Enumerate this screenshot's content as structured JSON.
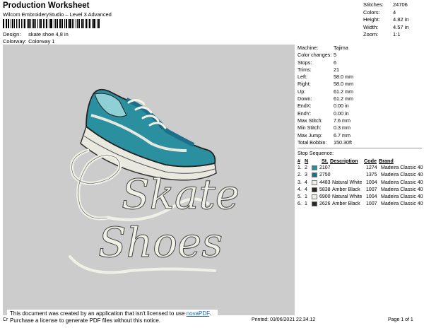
{
  "header": {
    "title": "Production Worksheet",
    "subtitle": "Wilcom EmbroideryStudio – Level 3 Advanced",
    "design_label": "Design:",
    "design_value": "skate shoe 4,8 in",
    "colorway_label": "Colorway:",
    "colorway_value": "Colorway 1"
  },
  "stats": [
    {
      "label": "Stitches:",
      "value": "24706"
    },
    {
      "label": "Colors:",
      "value": "4"
    },
    {
      "label": "Height:",
      "value": "4.82 in"
    },
    {
      "label": "Width:",
      "value": "4.57 in"
    },
    {
      "label": "Zoom:",
      "value": "1:1"
    }
  ],
  "details": [
    {
      "label": "Machine:",
      "value": "Tajima"
    },
    {
      "label": "Color changes:",
      "value": "5"
    },
    {
      "label": "Stops:",
      "value": "6"
    },
    {
      "label": "Trims:",
      "value": "21"
    },
    {
      "label": "Left:",
      "value": "58.0 mm"
    },
    {
      "label": "Right:",
      "value": "58.0 mm"
    },
    {
      "label": "Up:",
      "value": "61.2 mm"
    },
    {
      "label": "Down:",
      "value": "61.2 mm"
    },
    {
      "label": "EndX:",
      "value": "0.00 in"
    },
    {
      "label": "EndY:",
      "value": "0.00 in"
    },
    {
      "label": "Max Stitch:",
      "value": "7.6 mm"
    },
    {
      "label": "Min Stitch:",
      "value": "0.3 mm"
    },
    {
      "label": "Max Jump:",
      "value": "6.7 mm"
    },
    {
      "label": "Total Bobbin:",
      "value": "150.30ft"
    }
  ],
  "stop_sequence": {
    "title": "Stop Sequence:",
    "headers": [
      "#",
      "N",
      "St.",
      "Description",
      "Code",
      "Brand"
    ],
    "rows": [
      {
        "num": "1.",
        "n": "2",
        "color": "#2a8f9e",
        "st": "2107",
        "desc": "",
        "code": "1274",
        "brand": "Madeira Classic 40"
      },
      {
        "num": "2.",
        "n": "3",
        "color": "#1d6f8a",
        "st": "2750",
        "desc": "",
        "code": "1375",
        "brand": "Madeira Classic 40"
      },
      {
        "num": "3.",
        "n": "4",
        "color": "#efefe6",
        "st": "4483",
        "desc": "Natural White",
        "code": "1004",
        "brand": "Madeira Classic 40"
      },
      {
        "num": "4.",
        "n": "4",
        "color": "#2a2622",
        "st": "5838",
        "desc": "Amber Black",
        "code": "1007",
        "brand": "Madeira Classic 40"
      },
      {
        "num": "5.",
        "n": "1",
        "color": "#efefe6",
        "st": "6900",
        "desc": "Natural White",
        "code": "1004",
        "brand": "Madeira Classic 40"
      },
      {
        "num": "6.",
        "n": "1",
        "color": "#2a2622",
        "st": "2626",
        "desc": "Amber Black",
        "code": "1007",
        "brand": "Madeira Classic 40"
      }
    ]
  },
  "design_text": {
    "line1": "Skate",
    "line2": "Shoes"
  },
  "notice": {
    "line1_prefix": "This document was created by an application that isn't licensed to use ",
    "link": "novaPDF",
    "line1_suffix": ".",
    "line2": "Purchase a license to generate PDF files without this notice."
  },
  "footer": {
    "left": "Cr",
    "printed": "Printed: 03/06/2021 22.34.12",
    "page": "Page 1 of 1"
  }
}
